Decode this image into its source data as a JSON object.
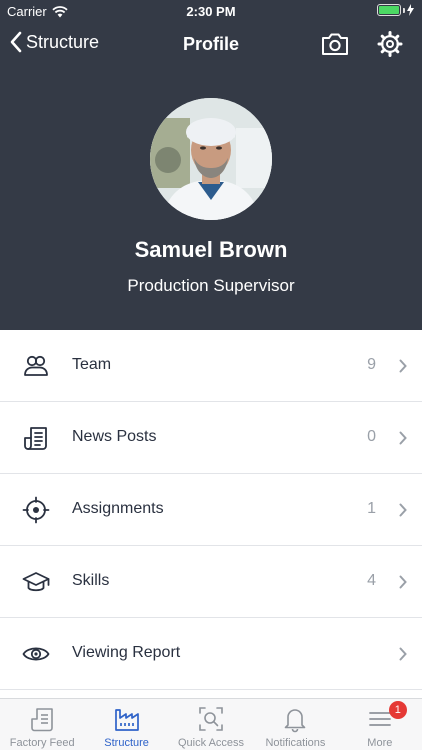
{
  "status_bar": {
    "carrier": "Carrier",
    "time": "2:30 PM",
    "battery_level": 1.0
  },
  "nav": {
    "back_label": "Structure",
    "title": "Profile"
  },
  "profile": {
    "name": "Samuel Brown",
    "role": "Production Supervisor"
  },
  "menu": [
    {
      "label": "Team",
      "count": "9",
      "icon": "team-icon"
    },
    {
      "label": "News Posts",
      "count": "0",
      "icon": "news-icon"
    },
    {
      "label": "Assignments",
      "count": "1",
      "icon": "target-icon"
    },
    {
      "label": "Skills",
      "count": "4",
      "icon": "graduation-cap-icon"
    },
    {
      "label": "Viewing Report",
      "count": "",
      "icon": "eye-icon"
    }
  ],
  "tabs": [
    {
      "label": "Factory Feed",
      "icon": "feed-icon",
      "active": false
    },
    {
      "label": "Structure",
      "icon": "factory-icon",
      "active": true
    },
    {
      "label": "Quick Access",
      "icon": "scan-icon",
      "active": false
    },
    {
      "label": "Notifications",
      "icon": "bell-icon",
      "active": false
    },
    {
      "label": "More",
      "icon": "menu-icon",
      "active": false,
      "badge": "1"
    }
  ],
  "colors": {
    "header_bg": "#343a46",
    "accent": "#2f63c9",
    "badge": "#e53935",
    "battery": "#4cd964"
  }
}
